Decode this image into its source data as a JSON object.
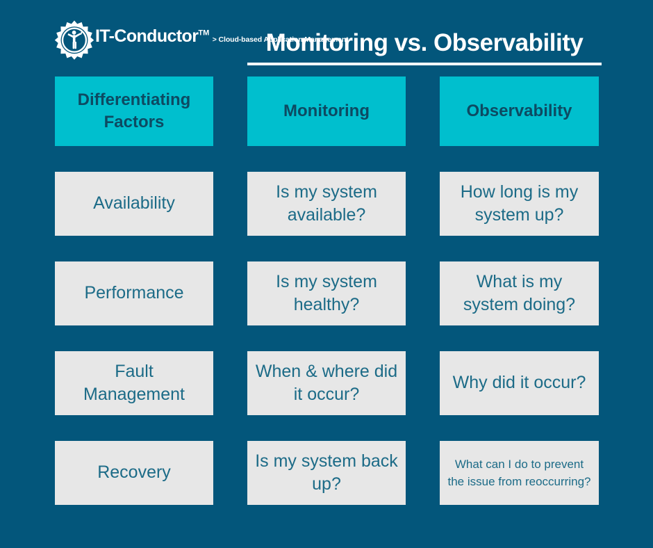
{
  "brand": {
    "name": "IT-Conductor",
    "trademark": "TM",
    "tagline": "> Cloud-based Application Management",
    "logo_icon": "gear-conductor-icon"
  },
  "header": {
    "title": "Monitoring vs. Observability"
  },
  "colors": {
    "background": "#03567B",
    "header_cell": "#00BFCE",
    "body_cell": "#E7E7E7",
    "header_text": "#0D4A62",
    "body_text": "#1C6B87",
    "title_text": "#FFFFFF"
  },
  "table": {
    "columns": [
      "Differentiating Factors",
      "Monitoring",
      "Observability"
    ],
    "rows": [
      {
        "factor": "Availability",
        "monitoring": "Is my system available?",
        "observability": "How long is my system up?"
      },
      {
        "factor": "Performance",
        "monitoring": "Is my system healthy?",
        "observability": "What is my system doing?"
      },
      {
        "factor": "Fault Management",
        "monitoring": "When & where did it occur?",
        "observability": "Why did it occur?"
      },
      {
        "factor": "Recovery",
        "monitoring": "Is my system back up?",
        "observability": "What can I do to prevent the issue from reoccurring?"
      }
    ]
  }
}
